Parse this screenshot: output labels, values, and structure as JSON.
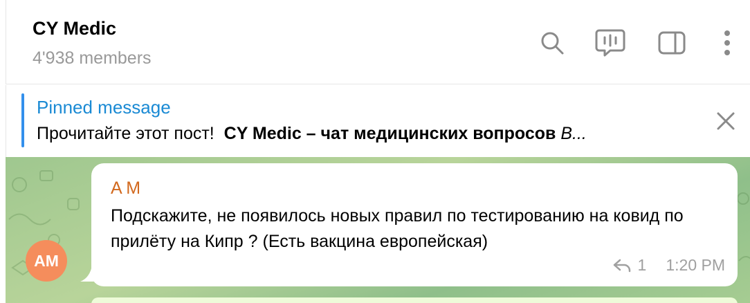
{
  "header": {
    "title": "CY Medic",
    "members": "4'938 members",
    "icons": [
      "search-icon",
      "voice-chat-icon",
      "sidebar-toggle-icon",
      "more-vertical-icon"
    ]
  },
  "pinned": {
    "label": "Pinned message",
    "text_plain": "Прочитайте этот пост!",
    "text_bold": "CY Medic – чат медицинских вопросов",
    "text_italic": "В..."
  },
  "messages": [
    {
      "sender": "A M",
      "avatar_initials": "AM",
      "text": "Подскажите, не появилось новых правил по тестированию на ковид по прилёту на Кипр ? (Есть вакцина европейская)",
      "replies": "1",
      "time": "1:20 PM"
    }
  ],
  "colors": {
    "accent": "#3390ec",
    "sender": "#d2691e",
    "avatar": "#f58d5c",
    "chat_bg": "#a6cc92"
  }
}
